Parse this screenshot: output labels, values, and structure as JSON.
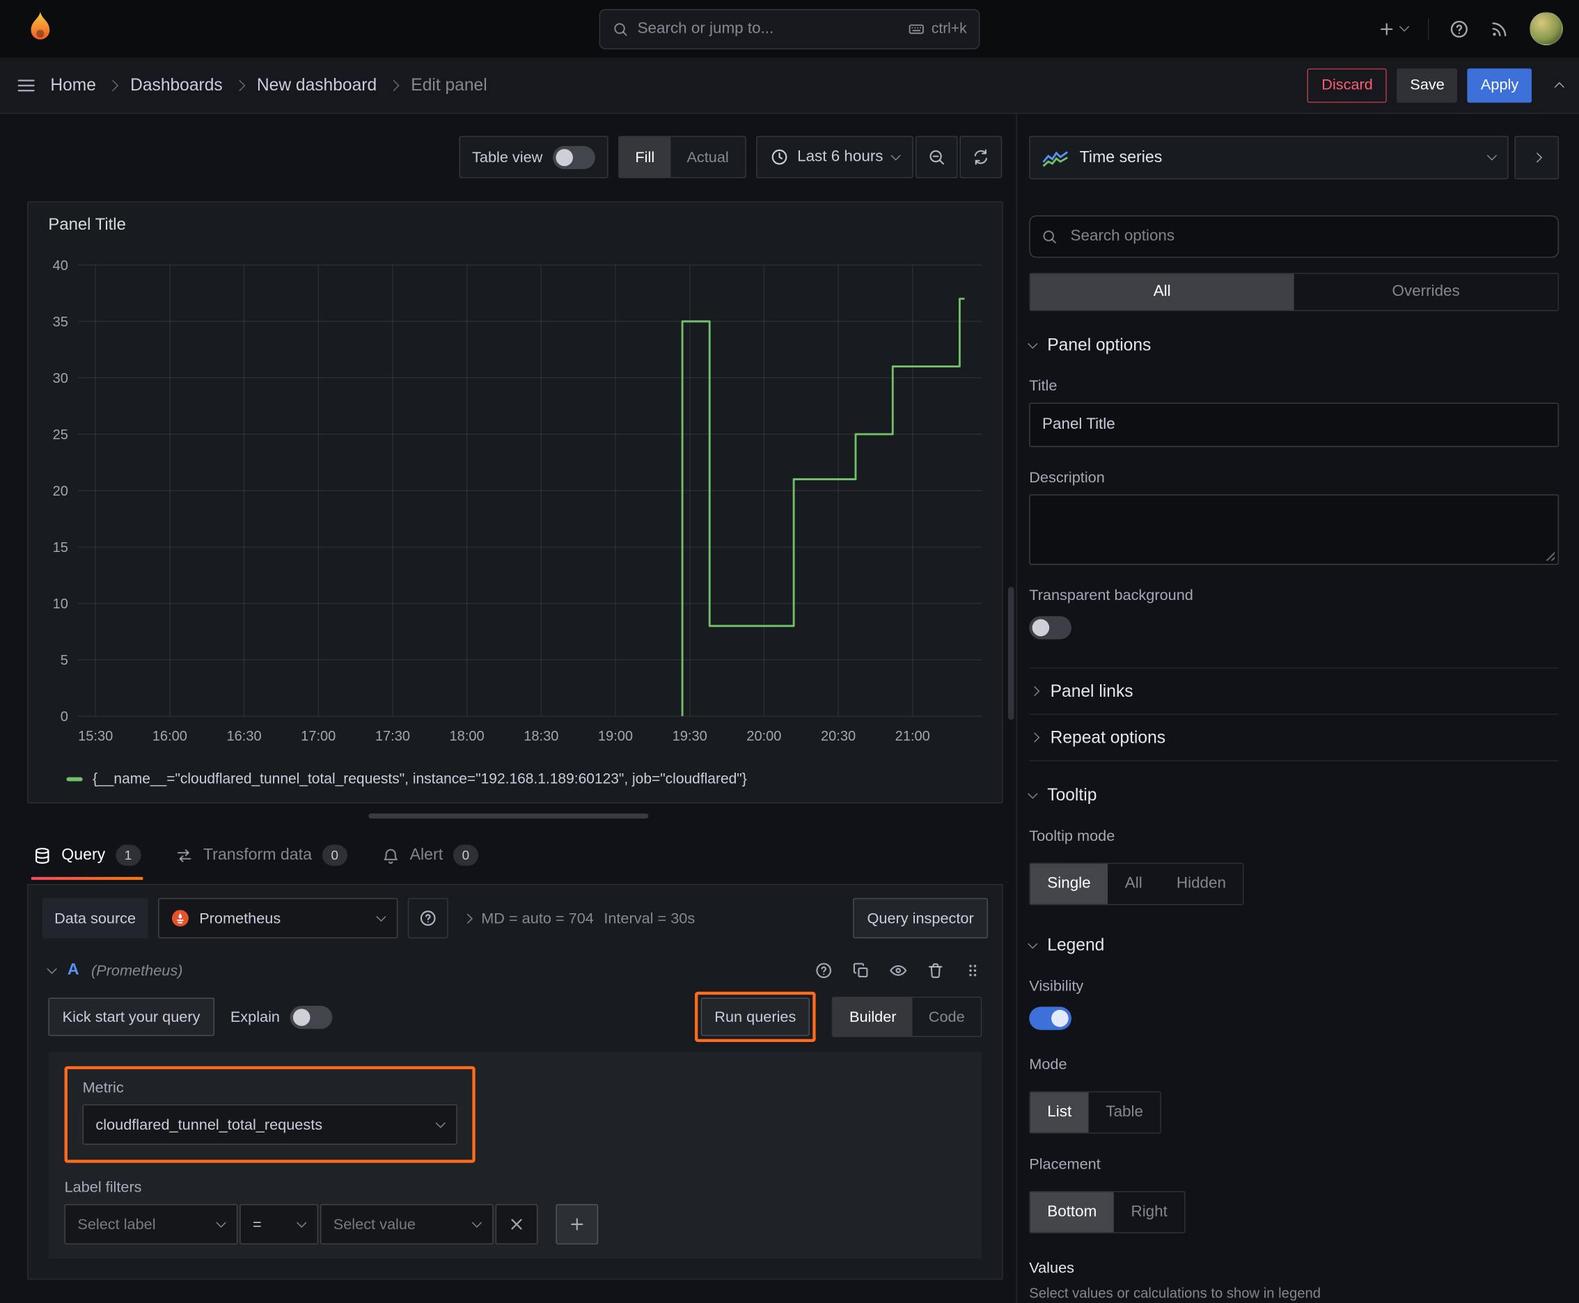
{
  "topbar": {
    "search": {
      "placeholder": "Search or jump to...",
      "shortcut": "ctrl+k"
    }
  },
  "breadcrumb": {
    "items": [
      "Home",
      "Dashboards",
      "New dashboard",
      "Edit panel"
    ]
  },
  "actions": {
    "discard": "Discard",
    "save": "Save",
    "apply": "Apply"
  },
  "toolbar": {
    "table_view": "Table view",
    "fill": "Fill",
    "actual": "Actual",
    "time_range": "Last 6 hours"
  },
  "panel": {
    "title": "Panel Title",
    "legend": "{__name__=\"cloudflared_tunnel_total_requests\", instance=\"192.168.1.189:60123\", job=\"cloudflared\"}"
  },
  "chart_data": {
    "type": "line",
    "title": "Panel Title",
    "x_unit": "minutes since 15:30",
    "x_range": [
      -7,
      358
    ],
    "y_range": [
      0,
      40
    ],
    "ylim": [
      0,
      40
    ],
    "grid": true,
    "legend_position": "bottom",
    "y_ticks": [
      0,
      5,
      10,
      15,
      20,
      25,
      30,
      35,
      40
    ],
    "x_ticks": [
      {
        "t": 0,
        "label": "15:30"
      },
      {
        "t": 30,
        "label": "16:00"
      },
      {
        "t": 60,
        "label": "16:30"
      },
      {
        "t": 90,
        "label": "17:00"
      },
      {
        "t": 120,
        "label": "17:30"
      },
      {
        "t": 150,
        "label": "18:00"
      },
      {
        "t": 180,
        "label": "18:30"
      },
      {
        "t": 210,
        "label": "19:00"
      },
      {
        "t": 240,
        "label": "19:30"
      },
      {
        "t": 270,
        "label": "20:00"
      },
      {
        "t": 300,
        "label": "20:30"
      },
      {
        "t": 330,
        "label": "21:00"
      }
    ],
    "series": [
      {
        "name": "{__name__=\"cloudflared_tunnel_total_requests\", instance=\"192.168.1.189:60123\", job=\"cloudflared\"}",
        "color": "#73bf69",
        "step": true,
        "points": [
          [
            237,
            0
          ],
          [
            237,
            35
          ],
          [
            248,
            35
          ],
          [
            248,
            8
          ],
          [
            282,
            8
          ],
          [
            282,
            21
          ],
          [
            307,
            21
          ],
          [
            307,
            25
          ],
          [
            322,
            25
          ],
          [
            322,
            31
          ],
          [
            349,
            31
          ],
          [
            349,
            37
          ],
          [
            351,
            37
          ]
        ]
      }
    ]
  },
  "tabs": {
    "query": {
      "label": "Query",
      "count": "1"
    },
    "transform": {
      "label": "Transform data",
      "count": "0"
    },
    "alert": {
      "label": "Alert",
      "count": "0"
    }
  },
  "query_editor": {
    "datasource_label": "Data source",
    "datasource_value": "Prometheus",
    "stats_md": "MD = auto = 704",
    "stats_interval": "Interval = 30s",
    "query_inspector": "Query inspector",
    "row_ref": "A",
    "row_ds": "(Prometheus)",
    "kick_start": "Kick start your query",
    "explain": "Explain",
    "run_queries": "Run queries",
    "builder": "Builder",
    "code": "Code",
    "metric_label": "Metric",
    "metric_value": "cloudflared_tunnel_total_requests",
    "label_filters_label": "Label filters",
    "select_label": "Select label",
    "operator": "=",
    "select_value": "Select value"
  },
  "options": {
    "viz_name": "Time series",
    "search_placeholder": "Search options",
    "tab_all": "All",
    "tab_overrides": "Overrides",
    "panel_options": {
      "header": "Panel options",
      "title_label": "Title",
      "title_value": "Panel Title",
      "description_label": "Description",
      "transparent_label": "Transparent background",
      "panel_links": "Panel links",
      "repeat_options": "Repeat options"
    },
    "tooltip": {
      "header": "Tooltip",
      "mode_label": "Tooltip mode",
      "modes": [
        "Single",
        "All",
        "Hidden"
      ]
    },
    "legend": {
      "header": "Legend",
      "visibility_label": "Visibility",
      "mode_label": "Mode",
      "modes": [
        "List",
        "Table"
      ],
      "placement_label": "Placement",
      "placements": [
        "Bottom",
        "Right"
      ],
      "values_label": "Values",
      "values_help": "Select values or calculations to show in legend"
    }
  },
  "states": {
    "table_view": false,
    "explain": false,
    "transparent_background": false,
    "legend_visibility": true
  },
  "colors": {
    "accent_blue": "#3d71d9",
    "line_green": "#73bf69",
    "annotation_orange": "#ff6b1a",
    "discard_red": "#f2495c",
    "grafana_orange": "#f05a28"
  }
}
